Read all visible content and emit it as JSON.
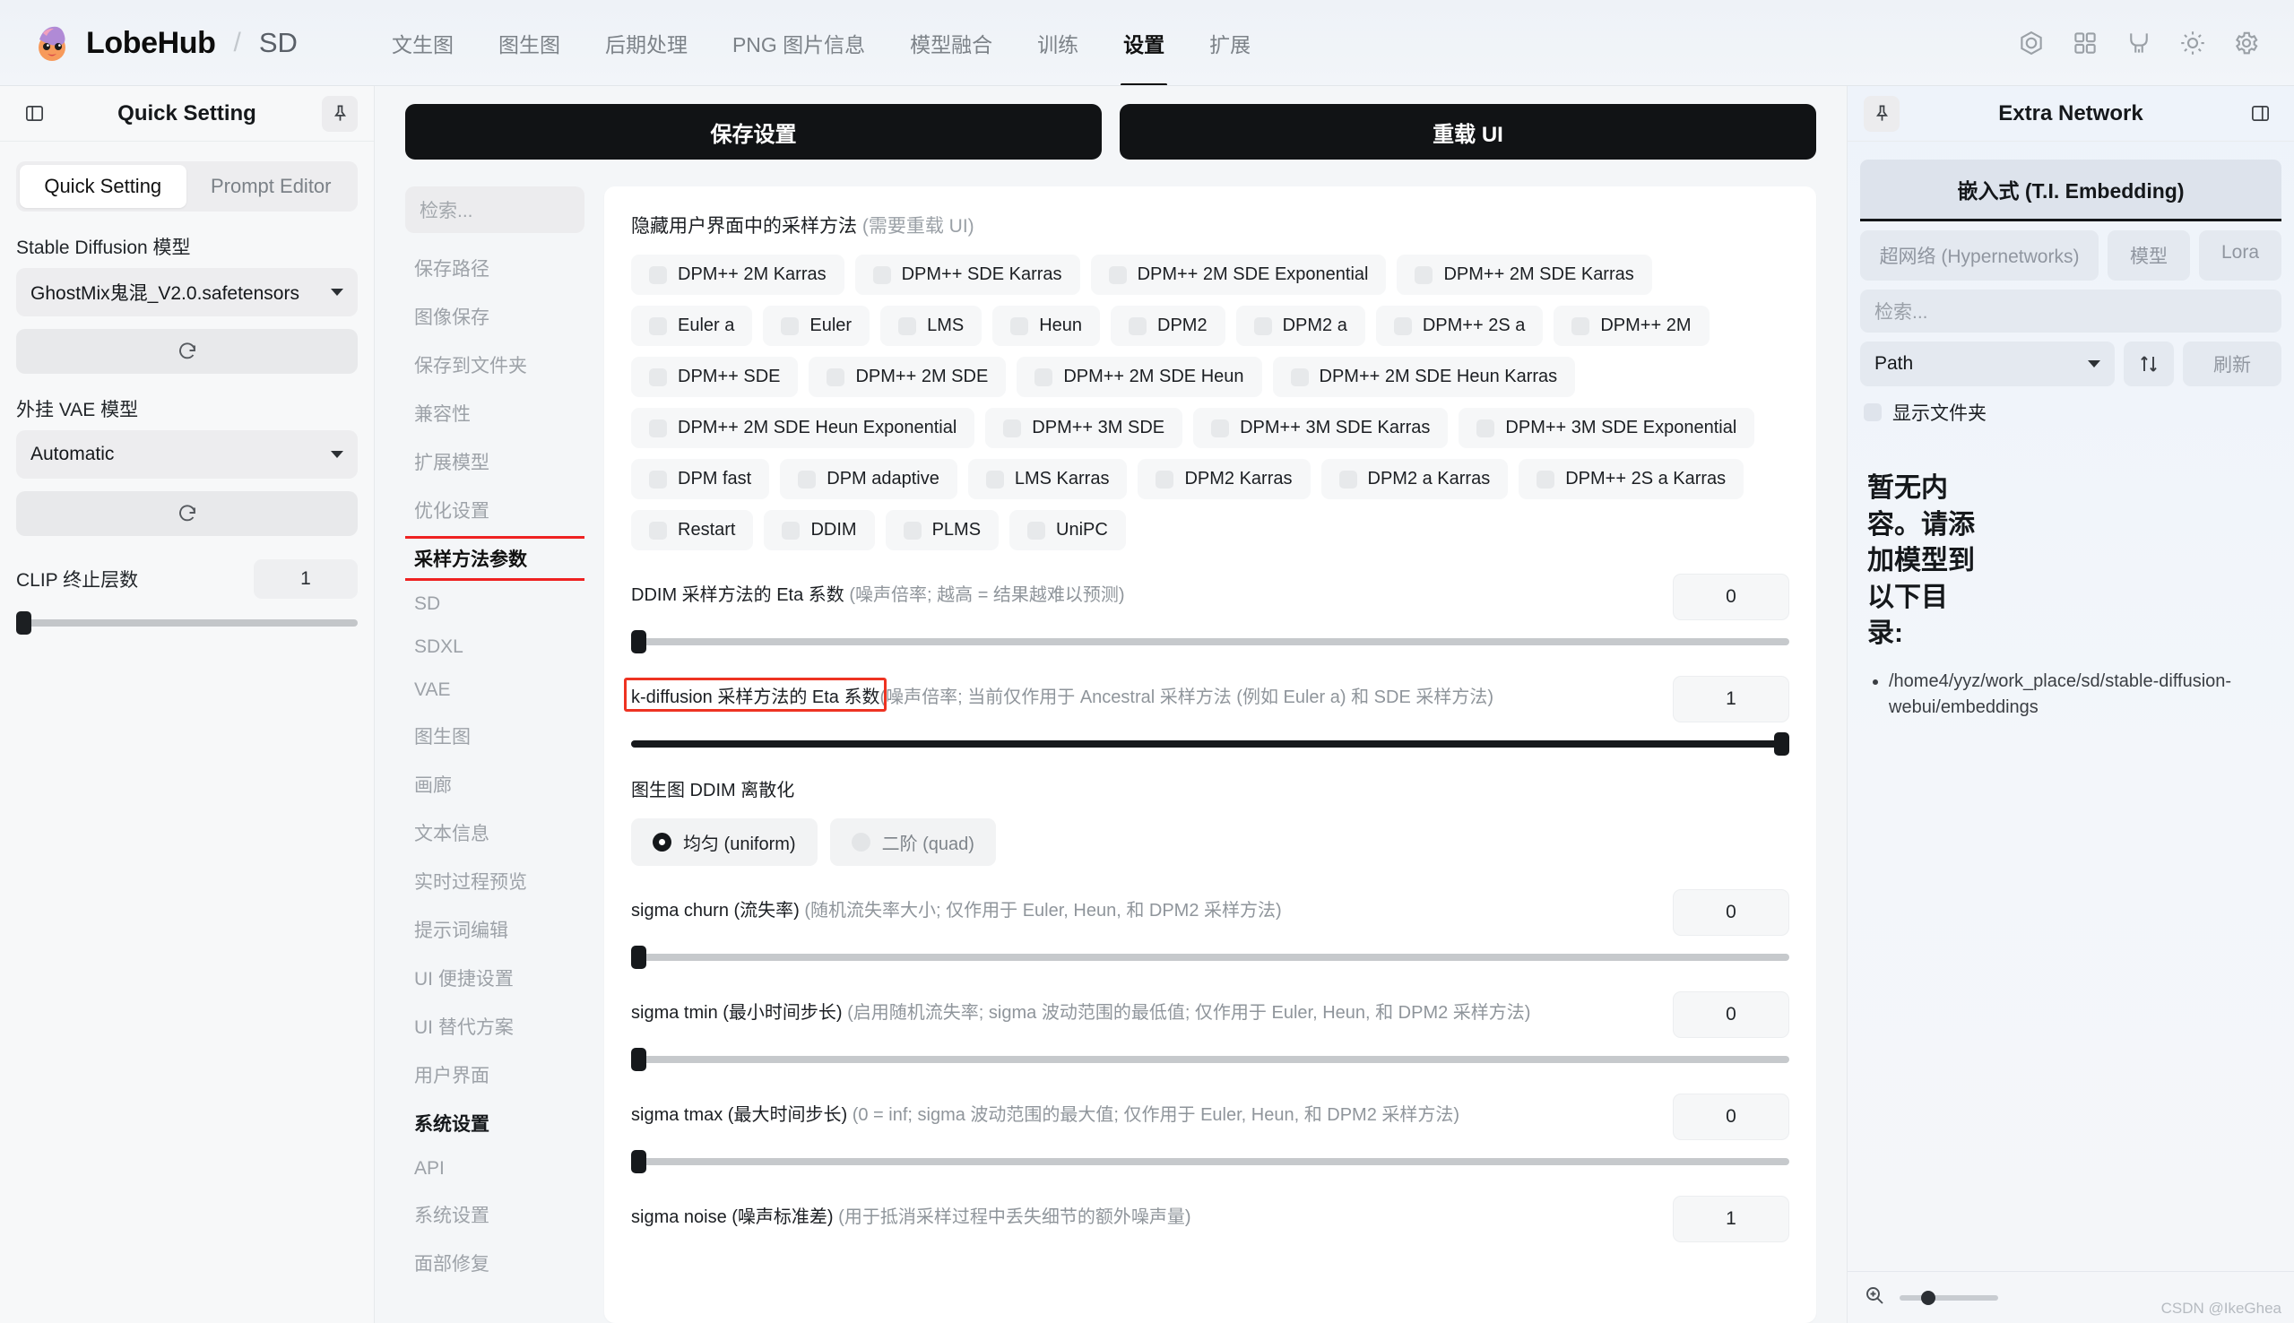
{
  "header": {
    "brand": "LobeHub",
    "separator": "/",
    "subtitle": "SD",
    "nav": [
      {
        "label": "文生图",
        "active": false
      },
      {
        "label": "图生图",
        "active": false
      },
      {
        "label": "后期处理",
        "active": false
      },
      {
        "label": "PNG 图片信息",
        "active": false
      },
      {
        "label": "模型融合",
        "active": false
      },
      {
        "label": "训练",
        "active": false
      },
      {
        "label": "设置",
        "active": true
      },
      {
        "label": "扩展",
        "active": false
      }
    ],
    "actions": [
      "civitai-icon",
      "grid-icon",
      "github-icon",
      "sun-icon",
      "gear-icon"
    ]
  },
  "left_panel": {
    "title": "Quick Setting",
    "collapse_icon": "panel-left-icon",
    "pin_icon": "pin-icon",
    "tabs": [
      {
        "label": "Quick Setting",
        "active": true
      },
      {
        "label": "Prompt Editor",
        "active": false
      }
    ],
    "model_label": "Stable Diffusion 模型",
    "model_value": "GhostMix鬼混_V2.0.safetensors",
    "vae_label": "外挂 VAE 模型",
    "vae_value": "Automatic",
    "refresh_icon": "refresh-icon",
    "clip_label": "CLIP 终止层数",
    "clip_value": "1",
    "clip_percent": 0
  },
  "actions": {
    "save": "保存设置",
    "reload": "重载 UI"
  },
  "settings_nav": {
    "search_placeholder": "检索...",
    "items": [
      {
        "label": "保存路径",
        "type": "item"
      },
      {
        "label": "图像保存",
        "type": "item"
      },
      {
        "label": "保存到文件夹",
        "type": "item"
      },
      {
        "label": "兼容性",
        "type": "item"
      },
      {
        "label": "扩展模型",
        "type": "item"
      },
      {
        "label": "优化设置",
        "type": "item"
      },
      {
        "label": "采样方法参数",
        "type": "selected"
      },
      {
        "label": "SD",
        "type": "item"
      },
      {
        "label": "SDXL",
        "type": "item"
      },
      {
        "label": "VAE",
        "type": "item"
      },
      {
        "label": "图生图",
        "type": "item"
      },
      {
        "label": "画廊",
        "type": "item"
      },
      {
        "label": "文本信息",
        "type": "item"
      },
      {
        "label": "实时过程预览",
        "type": "item"
      },
      {
        "label": "提示词编辑",
        "type": "item"
      },
      {
        "label": "UI 便捷设置",
        "type": "item"
      },
      {
        "label": "UI 替代方案",
        "type": "item"
      },
      {
        "label": "用户界面",
        "type": "item"
      },
      {
        "label": "系统设置",
        "type": "group"
      },
      {
        "label": "API",
        "type": "item"
      },
      {
        "label": "系统设置",
        "type": "item"
      },
      {
        "label": "面部修复",
        "type": "item"
      }
    ]
  },
  "main": {
    "hide_samplers_title": "隐藏用户界面中的采样方法",
    "hide_samplers_hint": "(需要重载 UI)",
    "sampler_rows": [
      [
        "DPM++ 2M Karras",
        "DPM++ SDE Karras",
        "DPM++ 2M SDE Exponential",
        "DPM++ 2M SDE Karras"
      ],
      [
        "Euler a",
        "Euler",
        "LMS",
        "Heun",
        "DPM2",
        "DPM2 a",
        "DPM++ 2S a",
        "DPM++ 2M"
      ],
      [
        "DPM++ SDE",
        "DPM++ 2M SDE",
        "DPM++ 2M SDE Heun",
        "DPM++ 2M SDE Heun Karras"
      ],
      [
        "DPM++ 2M SDE Heun Exponential",
        "DPM++ 3M SDE",
        "DPM++ 3M SDE Karras",
        "DPM++ 3M SDE Exponential"
      ],
      [
        "DPM fast",
        "DPM adaptive",
        "LMS Karras",
        "DPM2 Karras",
        "DPM2 a Karras",
        "DPM++ 2S a Karras"
      ],
      [
        "Restart",
        "DDIM",
        "PLMS",
        "UniPC"
      ]
    ],
    "params": [
      {
        "label_main": "DDIM 采样方法的 Eta 系数",
        "label_dim": "(噪声倍率; 越高 = 结果越难以预测)",
        "value": "0",
        "percent": 0,
        "highlight": false
      },
      {
        "label_main": "k-diffusion 采样方法的 Eta 系数",
        "label_dim": "(噪声倍率; 当前仅作用于 Ancestral 采样方法 (例如 Euler a) 和 SDE 采样方法)",
        "value": "1",
        "percent": 100,
        "highlight": true
      }
    ],
    "ddim_discretize": {
      "label": "图生图 DDIM 离散化",
      "options": [
        {
          "label": "均匀 (uniform)",
          "selected": true
        },
        {
          "label": "二阶 (quad)",
          "selected": false
        }
      ]
    },
    "sigma_params": [
      {
        "label_main": "sigma churn (流失率)",
        "label_dim": "(随机流失率大小; 仅作用于 Euler, Heun, 和 DPM2 采样方法)",
        "value": "0",
        "percent": 0
      },
      {
        "label_main": "sigma tmin (最小时间步长)",
        "label_dim": "(启用随机流失率; sigma 波动范围的最低值; 仅作用于 Euler, Heun, 和 DPM2 采样方法)",
        "value": "0",
        "percent": 0
      },
      {
        "label_main": "sigma tmax (最大时间步长)",
        "label_dim": "(0 = inf; sigma 波动范围的最大值; 仅作用于 Euler, Heun, 和 DPM2 采样方法)",
        "value": "0",
        "percent": 0
      },
      {
        "label_main": "sigma noise (噪声标准差)",
        "label_dim": "(用于抵消采样过程中丢失细节的额外噪声量)",
        "value": "1",
        "percent": 0
      }
    ]
  },
  "right_panel": {
    "title": "Extra Network",
    "pin_icon": "pin-icon",
    "collapse_icon": "panel-right-icon",
    "main_tab": "嵌入式 (T.I. Embedding)",
    "tabs": [
      {
        "label": "超网络 (Hypernetworks)"
      },
      {
        "label": "模型"
      },
      {
        "label": "Lora"
      }
    ],
    "search_placeholder": "检索...",
    "sort_value": "Path",
    "sort_icon": "sort-icon",
    "refresh_label": "刷新",
    "show_folder_label": "显示文件夹",
    "empty_text": "暂无内容。请添加模型到以下目录:",
    "paths": [
      "/home4/yyz/work_place/sd/stable-diffusion-webui/embeddings"
    ],
    "zoom_icon": "zoom-in-icon",
    "watermark": "CSDN @IkeGhea"
  }
}
